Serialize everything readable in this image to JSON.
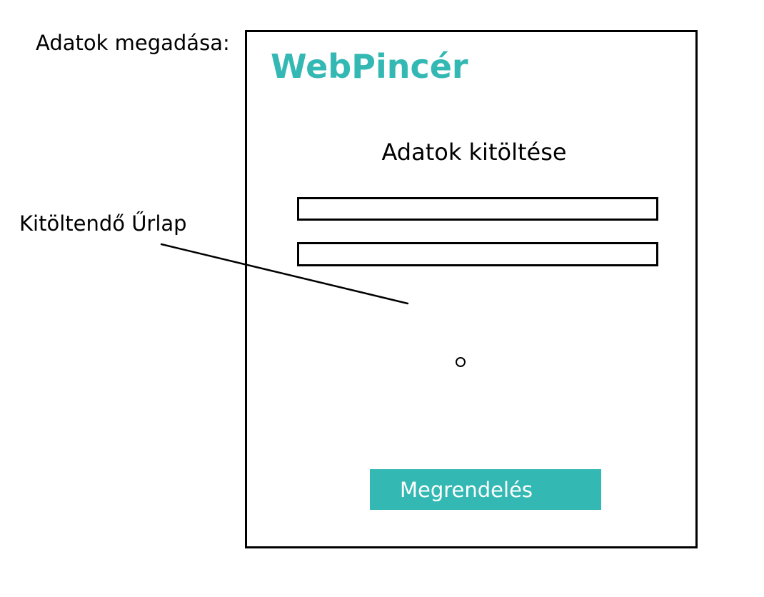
{
  "annotations": {
    "section_label": "Adatok megadása:",
    "form_callout": "Kitöltendő Űrlap"
  },
  "mockup": {
    "brand": "WebPincér",
    "form_title": "Adatok kitöltése",
    "fields": [
      {
        "value": "",
        "placeholder": ""
      },
      {
        "value": "",
        "placeholder": ""
      }
    ],
    "submit_label": "Megrendelés"
  },
  "colors": {
    "accent": "#33b8b4",
    "border": "#000000",
    "background": "#ffffff"
  },
  "icons": {
    "radio": "radio-circle-icon"
  }
}
